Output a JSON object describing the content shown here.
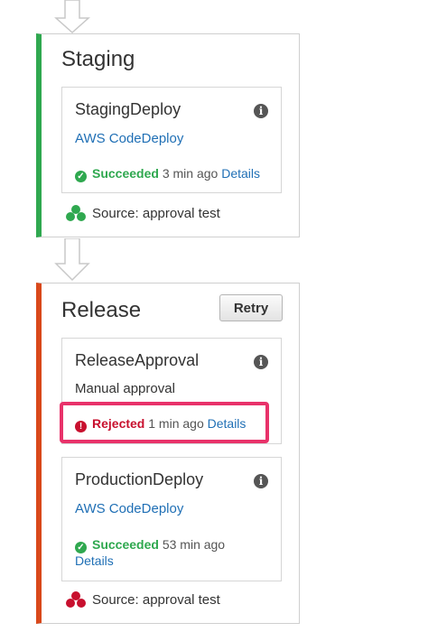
{
  "colors": {
    "success": "#2fa84f",
    "failure": "#d9481a",
    "rejected": "#c8102e",
    "link": "#1f6fb5",
    "highlight": "#e8326a"
  },
  "stages": {
    "staging": {
      "title": "Staging",
      "action": {
        "name": "StagingDeploy",
        "provider": "AWS CodeDeploy",
        "status": "Succeeded",
        "time": "3 min ago",
        "details": "Details"
      },
      "source": "Source: approval test"
    },
    "release": {
      "title": "Release",
      "retry_label": "Retry",
      "approval": {
        "name": "ReleaseApproval",
        "type": "Manual approval",
        "status": "Rejected",
        "time": "1 min ago",
        "details": "Details"
      },
      "deploy": {
        "name": "ProductionDeploy",
        "provider": "AWS CodeDeploy",
        "status": "Succeeded",
        "time": "53 min ago",
        "details": "Details"
      },
      "source": "Source: approval test"
    }
  },
  "icons": {
    "info": "info-icon",
    "ok": "check-circle-icon",
    "error": "exclamation-circle-icon",
    "source": "source-cluster-icon"
  }
}
